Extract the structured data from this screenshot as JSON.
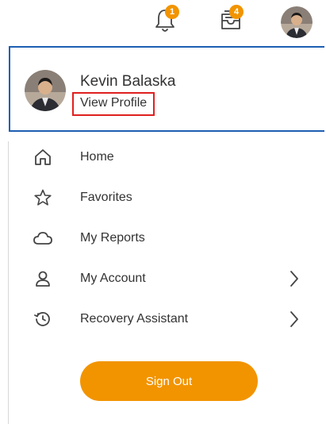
{
  "topbar": {
    "notifications": {
      "icon": "bell-icon",
      "badge": "1"
    },
    "inbox": {
      "icon": "inbox-tray-icon",
      "badge": "4"
    },
    "avatar": {
      "icon": "user-avatar"
    }
  },
  "profile": {
    "name": "Kevin Balaska",
    "view_profile_label": "View Profile"
  },
  "menu": {
    "items": [
      {
        "label": "Home",
        "icon": "home-icon",
        "chevron": false
      },
      {
        "label": "Favorites",
        "icon": "star-icon",
        "chevron": false
      },
      {
        "label": "My Reports",
        "icon": "cloud-icon",
        "chevron": false
      },
      {
        "label": "My Account",
        "icon": "person-icon",
        "chevron": true
      },
      {
        "label": "Recovery Assistant",
        "icon": "history-icon",
        "chevron": true
      }
    ]
  },
  "signout": {
    "label": "Sign Out"
  },
  "colors": {
    "accent": "#f29400",
    "profile_border": "#1d5fb3",
    "highlight_border": "#e02020",
    "text": "#333333"
  }
}
